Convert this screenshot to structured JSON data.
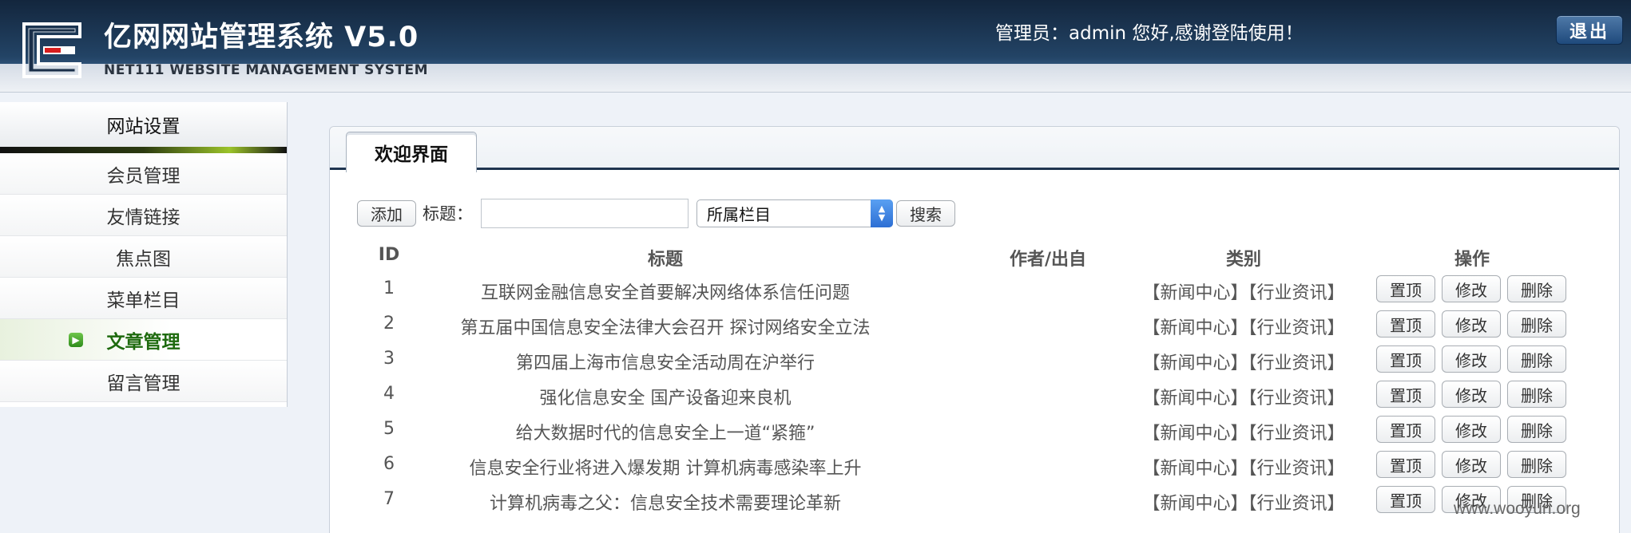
{
  "header": {
    "title": "亿网网站管理系统 V5.0",
    "subtitle": "NET111 WEBSITE MANAGEMENT SYSTEM",
    "welcome": "管理员：admin 您好,感谢登陆使用！",
    "logout_label": "退出"
  },
  "sidebar": {
    "heading": "网站设置",
    "items": [
      {
        "label": "会员管理"
      },
      {
        "label": "友情链接"
      },
      {
        "label": "焦点图"
      },
      {
        "label": "菜单栏目"
      },
      {
        "label": "文章管理",
        "active": true
      },
      {
        "label": "留言管理"
      }
    ]
  },
  "main": {
    "tab_label": "欢迎界面",
    "toolbar": {
      "add_label": "添加",
      "title_label": "标题：",
      "title_value": "",
      "select_value": "所属栏目",
      "search_label": "搜索"
    },
    "columns": {
      "id": "ID",
      "title": "标题",
      "author": "作者/出自",
      "category": "类别",
      "actions": "操作"
    },
    "rows": [
      {
        "id": "1",
        "title": "互联网金融信息安全首要解决网络体系信任问题",
        "author": "",
        "category": "【新闻中心】【行业资讯】"
      },
      {
        "id": "2",
        "title": "第五届中国信息安全法律大会召开 探讨网络安全立法",
        "author": "",
        "category": "【新闻中心】【行业资讯】"
      },
      {
        "id": "3",
        "title": "第四届上海市信息安全活动周在沪举行",
        "author": "",
        "category": "【新闻中心】【行业资讯】"
      },
      {
        "id": "4",
        "title": "强化信息安全 国产设备迎来良机",
        "author": "",
        "category": "【新闻中心】【行业资讯】"
      },
      {
        "id": "5",
        "title": "给大数据时代的信息安全上一道“紧箍”",
        "author": "",
        "category": "【新闻中心】【行业资讯】"
      },
      {
        "id": "6",
        "title": "信息安全行业将进入爆发期 计算机病毒感染率上升",
        "author": "",
        "category": "【新闻中心】【行业资讯】"
      },
      {
        "id": "7",
        "title": "计算机病毒之父：信息安全技术需要理论革新",
        "author": "",
        "category": "【新闻中心】【行业资讯】"
      }
    ],
    "row_actions": {
      "top": "置顶",
      "edit": "修改",
      "delete": "删除"
    }
  },
  "watermark": "www.wooyun.org"
}
